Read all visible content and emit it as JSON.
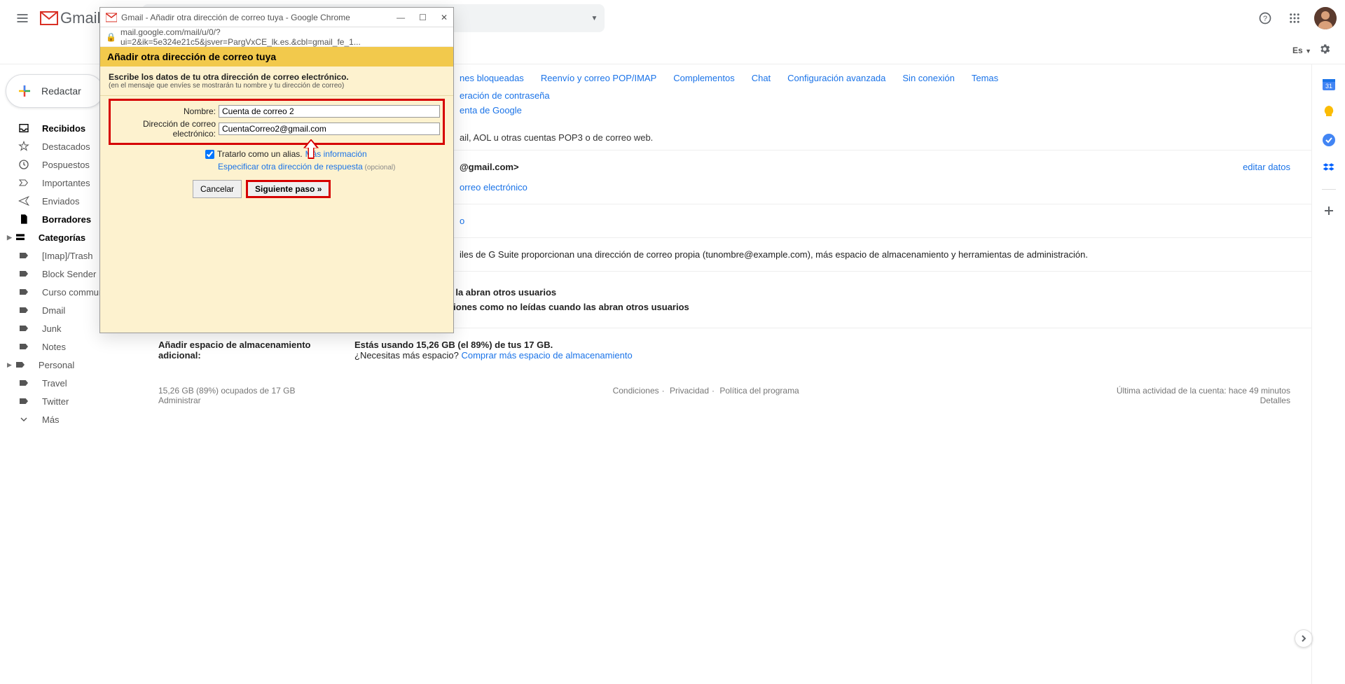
{
  "app": {
    "name": "Gmail"
  },
  "header": {
    "lang": "Es",
    "help_tooltip": "Help"
  },
  "compose": {
    "label": "Redactar"
  },
  "sidebar": {
    "items": [
      {
        "label": "Recibidos",
        "bold": true,
        "icon": "inbox"
      },
      {
        "label": "Destacados",
        "icon": "star"
      },
      {
        "label": "Pospuestos",
        "icon": "clock"
      },
      {
        "label": "Importantes",
        "icon": "imp"
      },
      {
        "label": "Enviados",
        "icon": "send"
      },
      {
        "label": "Borradores",
        "bold": true,
        "icon": "draft"
      },
      {
        "label": "Categorías",
        "bold": true,
        "icon": "cat",
        "arrow": true
      },
      {
        "label": "[Imap]/Trash",
        "icon": "label"
      },
      {
        "label": "Block Sender",
        "icon": "label"
      },
      {
        "label": "Curso community",
        "icon": "label"
      },
      {
        "label": "Dmail",
        "icon": "label"
      },
      {
        "label": "Junk",
        "icon": "label"
      },
      {
        "label": "Notes",
        "icon": "label"
      },
      {
        "label": "Personal",
        "icon": "label",
        "arrow": true
      },
      {
        "label": "Travel",
        "icon": "label"
      },
      {
        "label": "Twitter",
        "icon": "label"
      },
      {
        "label": "Más",
        "icon": "more"
      }
    ]
  },
  "tabs": [
    "nes bloqueadas",
    "Reenvío y correo POP/IMAP",
    "Complementos",
    "Chat",
    "Configuración avanzada",
    "Sin conexión",
    "Temas"
  ],
  "bg": {
    "line1": "eración de contraseña",
    "line2": "enta de Google",
    "line3": "ail, AOL u otras cuentas POP3 o de correo web.",
    "line4": "@gmail.com>",
    "line5": "orreo electrónico",
    "edit": "editar datos",
    "gsuite": "iles de G Suite proporcionan una dirección de correo propia (tunombre@example.com), más espacio de almacenamiento y herramientas de administración.",
    "mi": "Más información",
    "markread": "como leída cuando la abran otros usuarios",
    "markunread": "Dejar las conversaciones como no leídas cuando las abran otros usuarios",
    "storage_label": "Añadir espacio de almacenamiento adicional:",
    "storage_text": "Estás usando 15,26 GB (el 89%) de tus 17 GB.",
    "storage_q": "¿Necesitas más espacio? ",
    "storage_link": "Comprar más espacio de almacenamiento"
  },
  "footer": {
    "left1": "15,26 GB (89%) ocupados de 17 GB",
    "left2": "Administrar",
    "mid1": "Condiciones",
    "mid2": "Privacidad",
    "mid3": "Política del programa",
    "right1": "Última actividad de la cuenta: hace 49 minutos",
    "right2": "Detalles"
  },
  "popup": {
    "window_title": "Gmail - Añadir otra dirección de correo tuya - Google Chrome",
    "url": "mail.google.com/mail/u/0/?ui=2&ik=5e324e21c5&jsver=PargVxCE_lk.es.&cbl=gmail_fe_1...",
    "title": "Añadir otra dirección de correo tuya",
    "subtitle": "Escribe los datos de tu otra dirección de correo electrónico.",
    "subnote": "(en el mensaje que envíes se mostrarán tu nombre y tu dirección de correo)",
    "name_label": "Nombre:",
    "name_value": "Cuenta de correo 2",
    "email_label": "Dirección de correo electrónico:",
    "email_value": "CuentaCorreo2@gmail.com",
    "alias_label": "Tratarlo como un alias.",
    "alias_link": "Más información",
    "reply_link": "Especificar otra dirección de respuesta",
    "reply_opt": " (opcional)",
    "cancel": "Cancelar",
    "next": "Siguiente paso »"
  }
}
